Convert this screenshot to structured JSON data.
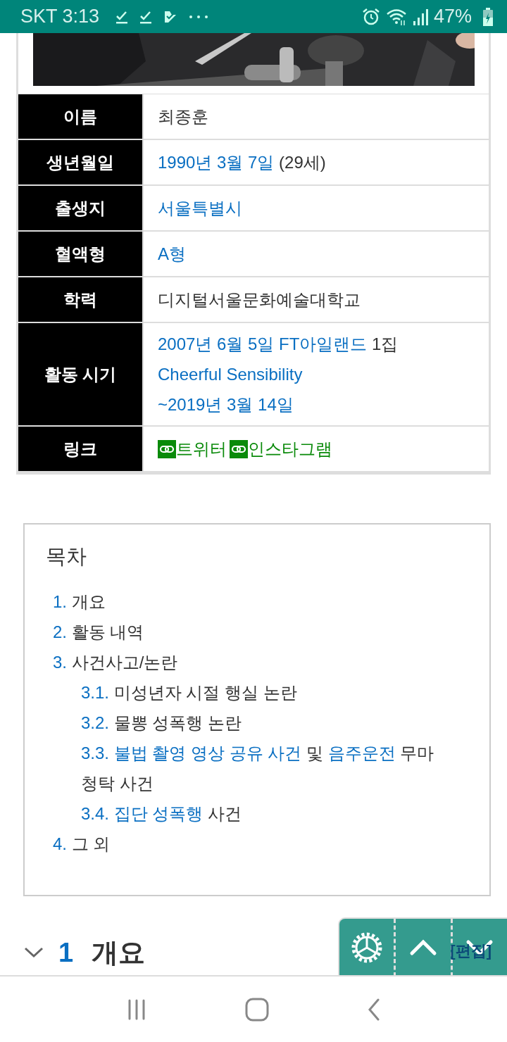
{
  "status_bar": {
    "carrier_time": "SKT 3:13",
    "battery": "47%"
  },
  "infobox": {
    "rows": [
      {
        "label": "이름",
        "lines": [
          [
            {
              "text": "최종훈",
              "link": false
            }
          ]
        ]
      },
      {
        "label": "생년월일",
        "lines": [
          [
            {
              "text": "1990년 3월 7일",
              "link": true
            },
            {
              "text": " (29세)",
              "link": false
            }
          ]
        ]
      },
      {
        "label": "출생지",
        "lines": [
          [
            {
              "text": "서울특별시",
              "link": true
            }
          ]
        ]
      },
      {
        "label": "혈액형",
        "lines": [
          [
            {
              "text": "A형",
              "link": true
            }
          ]
        ]
      },
      {
        "label": "학력",
        "lines": [
          [
            {
              "text": "디지털서울문화예술대학교",
              "link": false
            }
          ]
        ]
      },
      {
        "label": "활동 시기",
        "lines": [
          [
            {
              "text": "2007년 6월 5일 FT아일랜드",
              "link": true
            },
            {
              "text": " 1집",
              "link": false
            }
          ],
          [
            {
              "text": "Cheerful Sensibility",
              "link": true
            }
          ],
          [
            {
              "text": "~2019년 3월 14일",
              "link": true
            }
          ]
        ]
      },
      {
        "label": "링크",
        "external": [
          {
            "text": "트위터"
          },
          {
            "text": "인스타그램"
          }
        ]
      }
    ]
  },
  "toc": {
    "title": "목차",
    "items": [
      {
        "number": "1.",
        "parts": [
          {
            "text": "개요",
            "link": false
          }
        ]
      },
      {
        "number": "2.",
        "parts": [
          {
            "text": "활동 내역",
            "link": false
          }
        ]
      },
      {
        "number": "3.",
        "parts": [
          {
            "text": "사건사고/논란",
            "link": false
          }
        ],
        "children": [
          {
            "number": "3.1.",
            "parts": [
              {
                "text": "미성년자 시절 행실 논란",
                "link": false
              }
            ]
          },
          {
            "number": "3.2.",
            "parts": [
              {
                "text": "물뽕 성폭행 논란",
                "link": false
              }
            ]
          },
          {
            "number": "3.3.",
            "parts": [
              {
                "text": "불법 촬영 영상 공유 사건",
                "link": true
              },
              {
                "text": " 및 ",
                "link": false
              },
              {
                "text": "음주운전",
                "link": true
              },
              {
                "text": " 무마 청탁 사건",
                "link": false
              }
            ]
          },
          {
            "number": "3.4.",
            "parts": [
              {
                "text": "집단 성폭행",
                "link": true
              },
              {
                "text": " 사건",
                "link": false
              }
            ]
          }
        ]
      },
      {
        "number": "4.",
        "parts": [
          {
            "text": "그 외",
            "link": false
          }
        ]
      }
    ]
  },
  "section": {
    "number": "1",
    "title": "개요",
    "edit": "[편집]",
    "expanded": true
  }
}
